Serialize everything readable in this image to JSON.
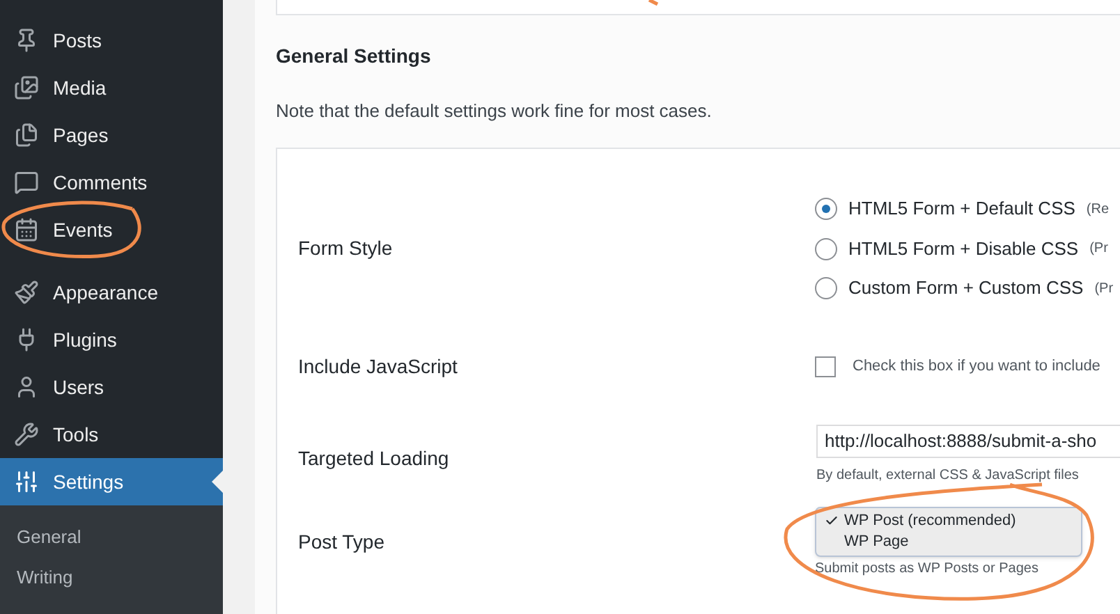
{
  "sidebar": {
    "items": [
      {
        "label": "Posts",
        "selected": false
      },
      {
        "label": "Media",
        "selected": false
      },
      {
        "label": "Pages",
        "selected": false
      },
      {
        "label": "Comments",
        "selected": false
      },
      {
        "label": "Events",
        "selected": false
      },
      {
        "label": "Appearance",
        "selected": false
      },
      {
        "label": "Plugins",
        "selected": false
      },
      {
        "label": "Users",
        "selected": false
      },
      {
        "label": "Tools",
        "selected": false
      },
      {
        "label": "Settings",
        "selected": true
      }
    ],
    "submenu": [
      {
        "label": "General",
        "selected": false
      },
      {
        "label": "Writing",
        "selected": false
      }
    ]
  },
  "section": {
    "title": "General Settings",
    "note": "Note that the default settings work fine for most cases."
  },
  "form": {
    "form_style": {
      "label": "Form Style",
      "options": [
        {
          "label": "HTML5 Form + Default CSS",
          "note": "(Re",
          "selected": true
        },
        {
          "label": "HTML5 Form + Disable CSS",
          "note": "(Pr",
          "selected": false
        },
        {
          "label": "Custom Form + Custom CSS",
          "note": "(Pr",
          "selected": false
        }
      ]
    },
    "include_javascript": {
      "label": "Include JavaScript",
      "checked": false,
      "text": "Check this box if you want to include"
    },
    "targeted_loading": {
      "label": "Targeted Loading",
      "value": "http://localhost:8888/submit-a-sho",
      "help": "By default, external CSS & JavaScript files"
    },
    "post_type": {
      "label": "Post Type",
      "options": [
        {
          "label": "WP Post (recommended)",
          "selected": true
        },
        {
          "label": "WP Page",
          "selected": false
        }
      ],
      "help": "Submit posts as WP Posts or Pages"
    }
  }
}
